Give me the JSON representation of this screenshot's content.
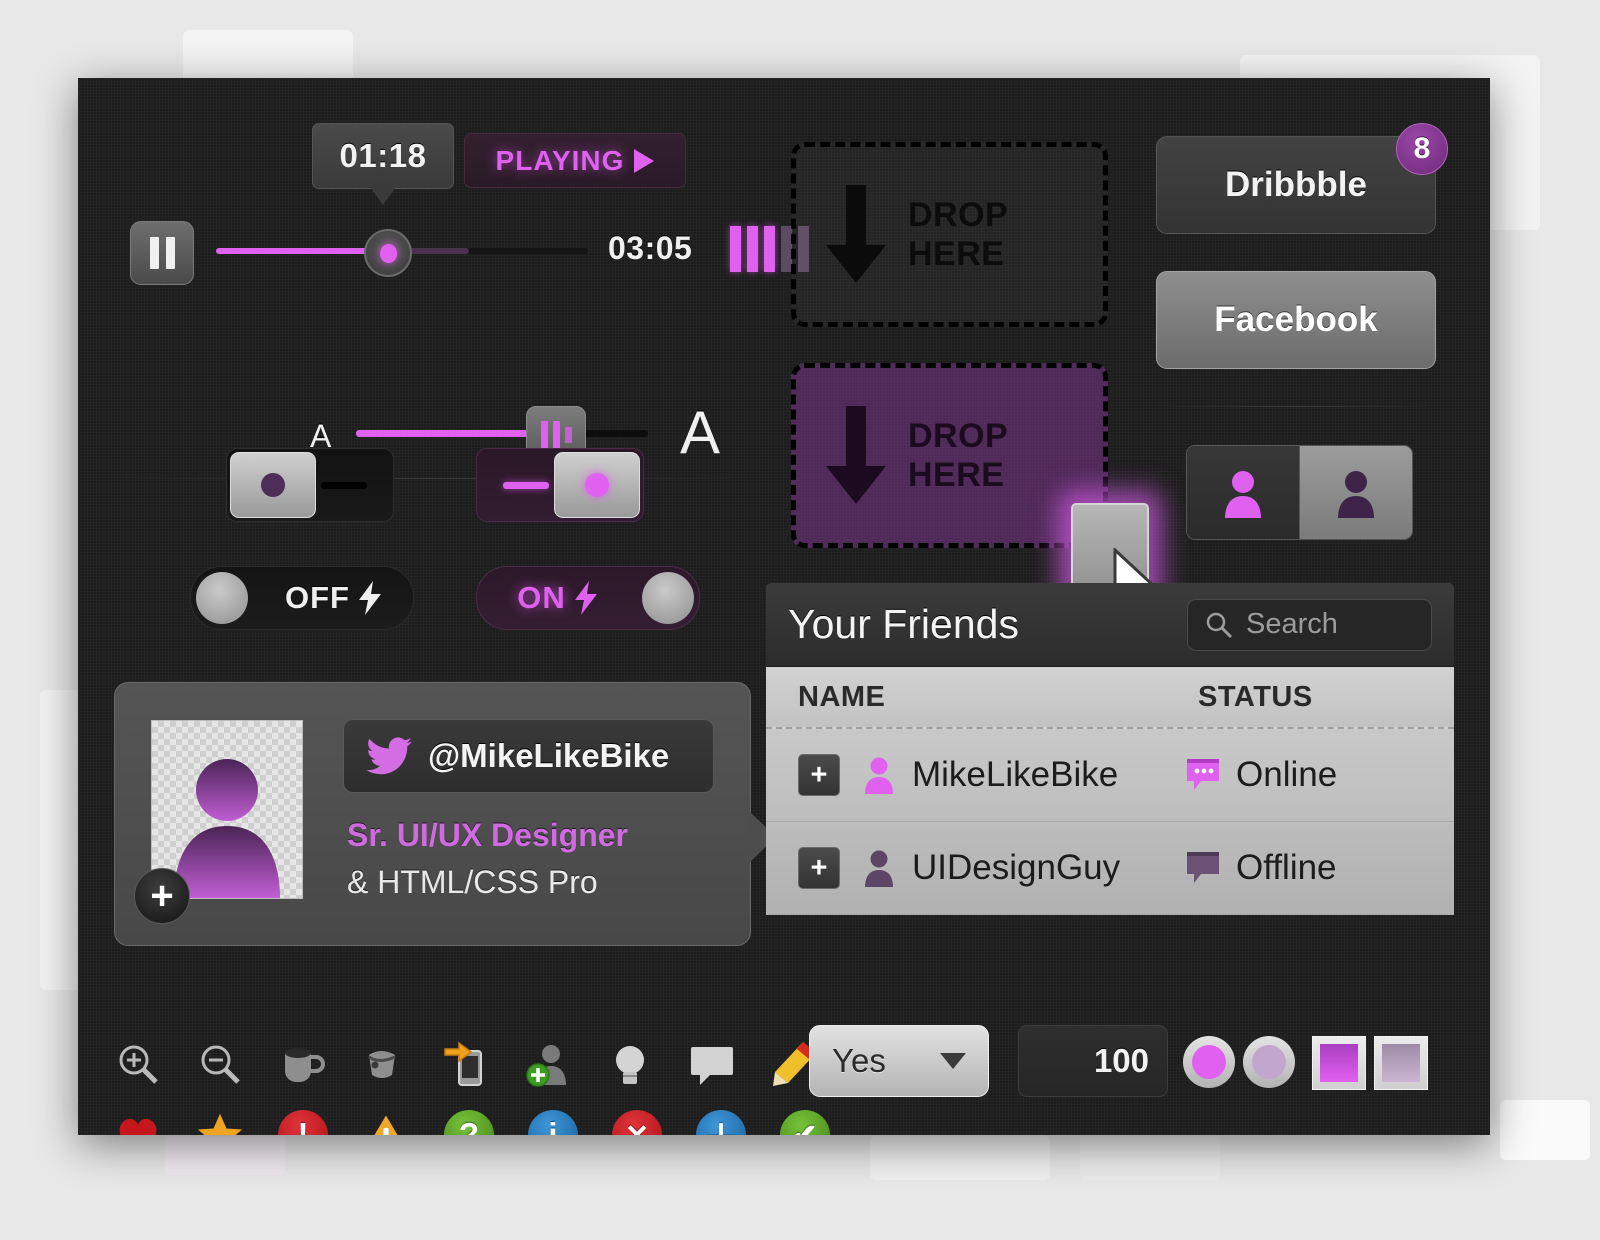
{
  "player": {
    "tooltip_time": "01:18",
    "status_label": "PLAYING",
    "status_play_icon": "play-triangle-icon",
    "pause_icon": "pause-icon",
    "total_time": "03:05",
    "seek_percent": 42,
    "buffer_percent": 68,
    "equalizer_bars": [
      1,
      1,
      1,
      0,
      0
    ],
    "font_small_label": "A",
    "font_large_label": "A",
    "font_slider_percent": 59
  },
  "toggles": {
    "switch_off_state": "off",
    "switch_on_state": "on",
    "pill_off_label": "OFF",
    "pill_on_label": "ON",
    "bolt_icon": "lightning-bolt-icon"
  },
  "profile": {
    "twitter_icon": "twitter-bird-icon",
    "handle": "@MikeLikeBike",
    "role_line1": "Sr. UI/UX Designer",
    "role_line2": "& HTML/CSS Pro",
    "add_label": "+",
    "avatar_icon": "user-avatar-icon"
  },
  "icon_row_tools": [
    {
      "name": "zoom-in-icon"
    },
    {
      "name": "zoom-out-icon"
    },
    {
      "name": "coffee-cup-icon"
    },
    {
      "name": "paint-bucket-icon"
    },
    {
      "name": "mobile-export-icon"
    },
    {
      "name": "add-user-icon"
    },
    {
      "name": "lightbulb-icon"
    },
    {
      "name": "comment-bubble-icon"
    },
    {
      "name": "pencil-edit-icon"
    }
  ],
  "icon_row_status": [
    {
      "name": "heart-icon",
      "glyph": "♥",
      "color": "#c4161c"
    },
    {
      "name": "star-icon",
      "glyph": "★",
      "color": "#eda420"
    },
    {
      "name": "error-icon",
      "glyph": "!",
      "color": "#c2161c"
    },
    {
      "name": "warning-icon",
      "glyph": "!",
      "color": "#f0a62a"
    },
    {
      "name": "help-icon",
      "glyph": "?",
      "color": "#5aa520"
    },
    {
      "name": "info-icon",
      "glyph": "i",
      "color": "#1b75bb"
    },
    {
      "name": "close-icon",
      "glyph": "✕",
      "color": "#c2161c"
    },
    {
      "name": "add-icon",
      "glyph": "＋",
      "color": "#1b75bb"
    },
    {
      "name": "check-icon",
      "glyph": "✔",
      "color": "#5aa520"
    }
  ],
  "dropzones": [
    {
      "line1": "DROP",
      "line2": "HERE",
      "state": "idle",
      "arrow_icon": "arrow-down-icon"
    },
    {
      "line1": "DROP",
      "line2": "HERE",
      "state": "active",
      "arrow_icon": "arrow-down-icon"
    }
  ],
  "social": {
    "dribbble_label": "Dribbble",
    "facebook_label": "Facebook",
    "badge_count": "8",
    "segment_left_icon": "user-icon-active",
    "segment_right_icon": "user-icon-inactive"
  },
  "friends": {
    "title": "Your Friends",
    "search_placeholder": "Search",
    "search_icon": "search-icon",
    "columns": [
      "NAME",
      "STATUS"
    ],
    "rows": [
      {
        "expand": "+",
        "user_icon": "user-icon",
        "name": "MikeLikeBike",
        "status_icon": "chat-bubble-icon",
        "status": "Online"
      },
      {
        "expand": "+",
        "user_icon": "user-icon",
        "name": "UIDesignGuy",
        "status_icon": "chat-bubble-icon",
        "status": "Offline"
      }
    ]
  },
  "bottom_controls": {
    "select_value": "Yes",
    "select_caret_icon": "chevron-down-icon",
    "number_value": "100",
    "radio_on": "selected",
    "radio_off": "unselected",
    "checkbox_on": "checked",
    "checkbox_off": "unchecked"
  },
  "theme": {
    "accent": "#e060f0",
    "panel_bg": "#1d1d1d",
    "page_bg": "#e8e8e8"
  }
}
